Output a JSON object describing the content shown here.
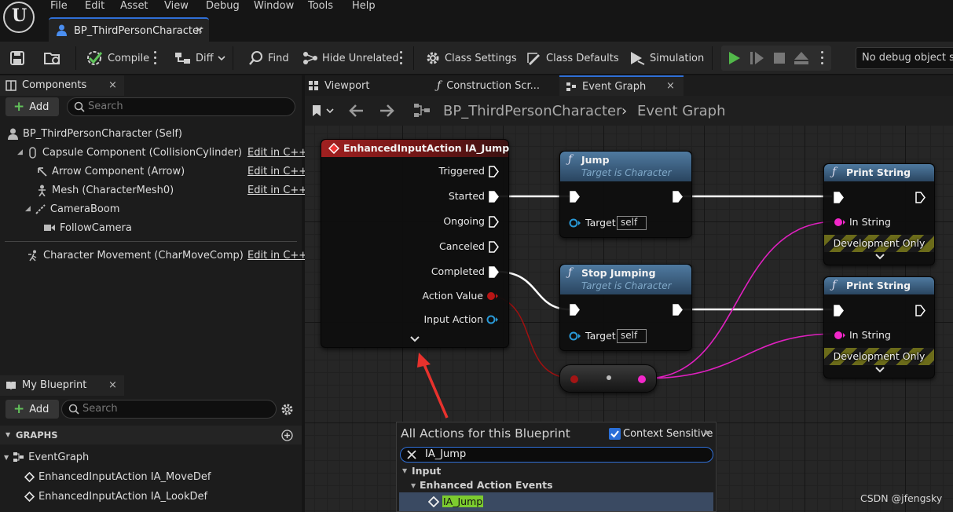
{
  "menu": [
    "File",
    "Edit",
    "Asset",
    "View",
    "Debug",
    "Window",
    "Tools",
    "Help"
  ],
  "doc_tab": {
    "title": "BP_ThirdPersonCharacter",
    "close": "×"
  },
  "toolbar": {
    "compile": "Compile",
    "diff": "Diff",
    "find": "Find",
    "hide_unrelated": "Hide Unrelated",
    "class_settings": "Class Settings",
    "class_defaults": "Class Defaults",
    "simulation": "Simulation",
    "debug_object": "No debug object selected"
  },
  "components": {
    "tab": "Components",
    "close": "×",
    "add": "Add",
    "search_placeholder": "Search",
    "edit_cpp": "Edit in C++",
    "items": [
      "BP_ThirdPersonCharacter (Self)",
      "Capsule Component (CollisionCylinder)",
      "Arrow Component (Arrow)",
      "Mesh (CharacterMesh0)",
      "CameraBoom",
      "FollowCamera",
      "Character Movement (CharMoveComp)"
    ]
  },
  "my_blueprint": {
    "tab": "My Blueprint",
    "close": "×",
    "add": "Add",
    "search_placeholder": "Search",
    "graphs_header": "GRAPHS",
    "event_graph": "EventGraph",
    "items": [
      "EnhancedInputAction IA_MoveDef",
      "EnhancedInputAction IA_LookDef"
    ]
  },
  "editor_tabs": [
    "Viewport",
    "Construction Scr...",
    "Event Graph"
  ],
  "editor_tab_close": "×",
  "breadcrumb": {
    "blueprint": "BP_ThirdPersonCharacter",
    "graph": "Event Graph"
  },
  "nodes": {
    "input_action": {
      "title": "EnhancedInputAction IA_Jump",
      "pins": [
        "Triggered",
        "Started",
        "Ongoing",
        "Canceled",
        "Completed",
        "Action Value",
        "Input Action"
      ]
    },
    "jump": {
      "title": "Jump",
      "subtitle": "Target is Character",
      "target_label": "Target",
      "target_value": "self"
    },
    "stop_jumping": {
      "title": "Stop Jumping",
      "subtitle": "Target is Character",
      "target_label": "Target",
      "target_value": "self"
    },
    "print_string_1": {
      "title": "Print String",
      "in_string": "In String",
      "dev_only": "Development Only"
    },
    "print_string_2": {
      "title": "Print String",
      "in_string": "In String",
      "dev_only": "Development Only"
    }
  },
  "action_menu": {
    "title": "All Actions for this Blueprint",
    "context_sensitive": "Context Sensitive",
    "search_value": "IA_Jump",
    "category": "Input",
    "subcategory": "Enhanced Action Events",
    "result": "IA_Jump"
  },
  "watermark": "CSDN @jfengsky",
  "colors": {
    "accent": "#2f6fd6",
    "event_header": "#8f1e1e",
    "function_header": "#3f6585",
    "exec_wire": "#ffffff",
    "string_pin": "#f227c9",
    "struct_pin": "#b11515",
    "object_pin": "#2a9ad8",
    "highlight": "#7ccb2f"
  }
}
